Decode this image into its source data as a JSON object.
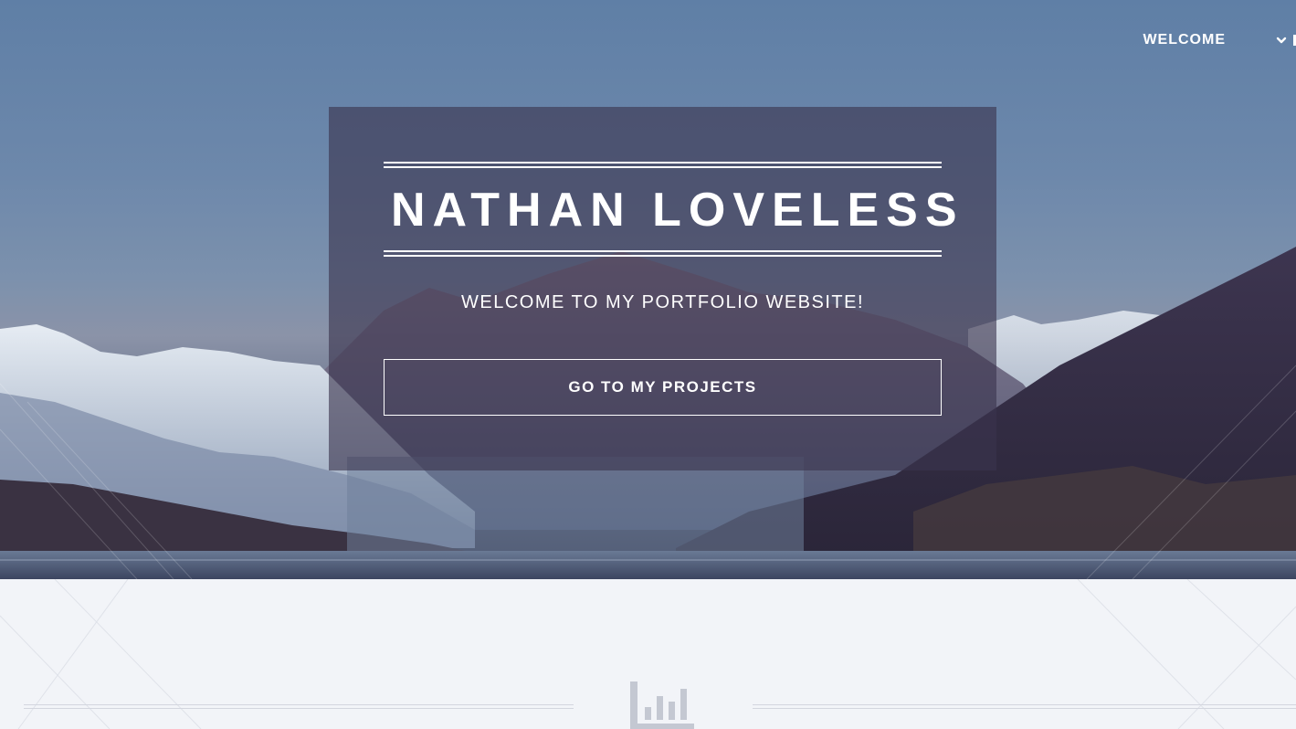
{
  "nav": {
    "welcome_label": "WELCOME",
    "dropdown_icon": "chevron-down-icon"
  },
  "hero": {
    "title": "NATHAN LOVELESS",
    "subtitle": "WELCOME TO MY PORTFOLIO WEBSITE!",
    "cta_label": "GO TO MY PROJECTS",
    "background": "mountain-lake-landscape"
  },
  "section": {
    "icon": "bar-chart-icon"
  },
  "colors": {
    "panel_overlay": "#3a344e",
    "text": "#ffffff",
    "lower_background": "#f2f4f8",
    "divider": "#d3d6df",
    "icon": "#c4c8d2"
  }
}
